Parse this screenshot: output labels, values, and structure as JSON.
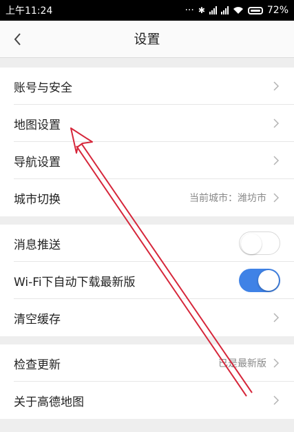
{
  "status_bar": {
    "time": "上午11:24",
    "dots": "···",
    "bluetooth_icon": "bluetooth-icon",
    "battery": "72%"
  },
  "header": {
    "title": "设置",
    "back_icon": "chevron-left-icon"
  },
  "groups": [
    {
      "items": [
        {
          "label": "账号与安全"
        },
        {
          "label": "地图设置"
        },
        {
          "label": "导航设置"
        },
        {
          "label": "城市切换",
          "value": "当前城市：潍坊市"
        }
      ]
    },
    {
      "items": [
        {
          "label": "消息推送",
          "toggle": "off"
        },
        {
          "label": "Wi-Fi下自动下载最新版",
          "toggle": "on"
        },
        {
          "label": "清空缓存"
        }
      ]
    },
    {
      "items": [
        {
          "label": "检查更新",
          "value": "已是最新版"
        },
        {
          "label": "关于高德地图"
        }
      ]
    }
  ],
  "colors": {
    "toggle_on": "#3f82e6",
    "annotation_arrow": "#d6263a",
    "background": "#eeeeee"
  }
}
